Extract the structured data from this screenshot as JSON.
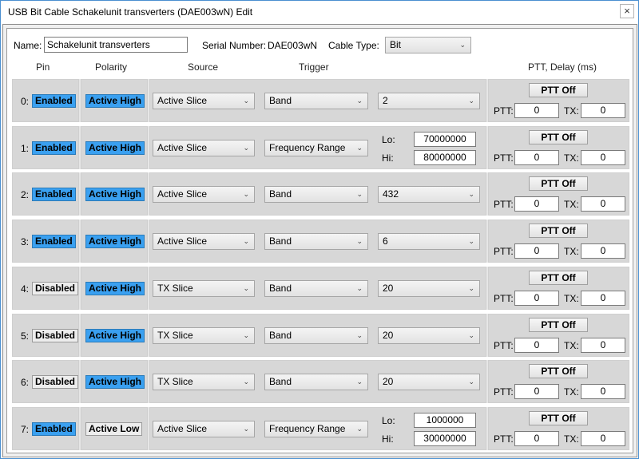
{
  "window": {
    "title": "USB Bit Cable Schakelunit transverters (DAE003wN) Edit",
    "close_glyph": "×"
  },
  "header": {
    "name_label": "Name:",
    "name_value": "Schakelunit transverters",
    "serial_label": "Serial Number:",
    "serial_value": "DAE003wN",
    "cable_type_label": "Cable Type:",
    "cable_type_value": "Bit"
  },
  "columns": {
    "pin": "Pin",
    "polarity": "Polarity",
    "source": "Source",
    "trigger": "Trigger",
    "ptt_delay": "PTT, Delay (ms)"
  },
  "labels": {
    "lo": "Lo:",
    "hi": "Hi:",
    "ptt": "PTT:",
    "tx": "TX:",
    "ptt_button": "PTT Off"
  },
  "colors": {
    "enabled": "#3aa0f0",
    "disabled": "#ededed",
    "active_high": "#3aa0f0",
    "active_low": "#ededed"
  },
  "pins": [
    {
      "pin": "0:",
      "state": "Enabled",
      "polarity": "Active High",
      "source": "Active Slice",
      "trigger": "Band",
      "value": "2",
      "lo": "",
      "hi": "",
      "ptt": "0",
      "tx": "0"
    },
    {
      "pin": "1:",
      "state": "Enabled",
      "polarity": "Active High",
      "source": "Active Slice",
      "trigger": "Frequency Range",
      "value": "",
      "lo": "70000000",
      "hi": "80000000",
      "ptt": "0",
      "tx": "0"
    },
    {
      "pin": "2:",
      "state": "Enabled",
      "polarity": "Active High",
      "source": "Active Slice",
      "trigger": "Band",
      "value": "432",
      "lo": "",
      "hi": "",
      "ptt": "0",
      "tx": "0"
    },
    {
      "pin": "3:",
      "state": "Enabled",
      "polarity": "Active High",
      "source": "Active Slice",
      "trigger": "Band",
      "value": "6",
      "lo": "",
      "hi": "",
      "ptt": "0",
      "tx": "0"
    },
    {
      "pin": "4:",
      "state": "Disabled",
      "polarity": "Active High",
      "source": "TX Slice",
      "trigger": "Band",
      "value": "20",
      "lo": "",
      "hi": "",
      "ptt": "0",
      "tx": "0"
    },
    {
      "pin": "5:",
      "state": "Disabled",
      "polarity": "Active High",
      "source": "TX Slice",
      "trigger": "Band",
      "value": "20",
      "lo": "",
      "hi": "",
      "ptt": "0",
      "tx": "0"
    },
    {
      "pin": "6:",
      "state": "Disabled",
      "polarity": "Active High",
      "source": "TX Slice",
      "trigger": "Band",
      "value": "20",
      "lo": "",
      "hi": "",
      "ptt": "0",
      "tx": "0"
    },
    {
      "pin": "7:",
      "state": "Enabled",
      "polarity": "Active Low",
      "source": "Active Slice",
      "trigger": "Frequency Range",
      "value": "",
      "lo": "1000000",
      "hi": "30000000",
      "ptt": "0",
      "tx": "0"
    }
  ]
}
